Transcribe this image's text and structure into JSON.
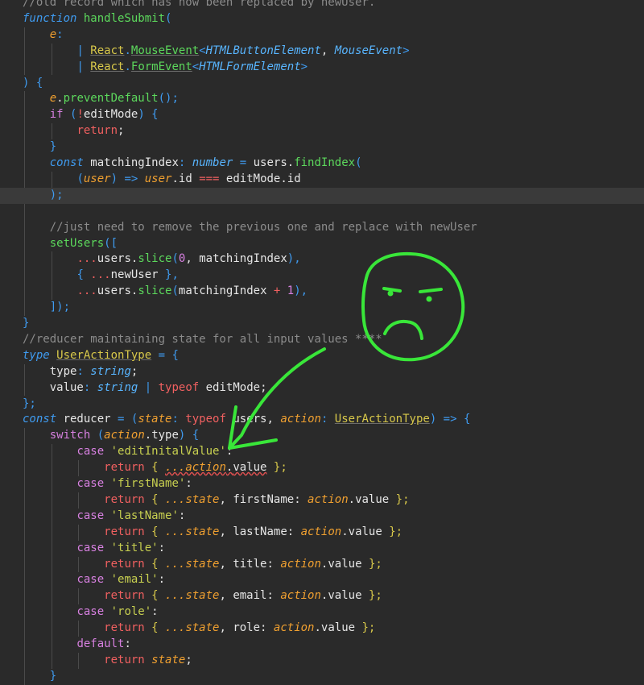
{
  "editor": {
    "background": "#2a2a2a",
    "highlight_color": "#3a3a3a",
    "annotation_color": "#39e639",
    "lines": [
      [
        {
          "t": "//old record which has now been replaced by newUser.",
          "c": "tok-comment"
        }
      ],
      [
        {
          "t": "function ",
          "c": "tok-storage"
        },
        {
          "t": "handleSubmit",
          "c": "tok-func"
        },
        {
          "t": "(",
          "c": "tok-punct"
        }
      ],
      [
        {
          "t": "    ",
          "c": "tok-ident"
        },
        {
          "t": "e",
          "c": "tok-param"
        },
        {
          "t": ":",
          "c": "tok-punct"
        }
      ],
      [
        {
          "t": "        ",
          "c": "tok-ident"
        },
        {
          "t": "| ",
          "c": "tok-punct"
        },
        {
          "t": "React",
          "c": "tok-typeu"
        },
        {
          "t": ".",
          "c": "tok-punct"
        },
        {
          "t": "MouseEvent",
          "c": "tok-typeg"
        },
        {
          "t": "<",
          "c": "tok-punct"
        },
        {
          "t": "HTMLButtonElement",
          "c": "tok-type"
        },
        {
          "t": ", ",
          "c": "tok-ident"
        },
        {
          "t": "MouseEvent",
          "c": "tok-type"
        },
        {
          "t": ">",
          "c": "tok-punct"
        }
      ],
      [
        {
          "t": "        ",
          "c": "tok-ident"
        },
        {
          "t": "| ",
          "c": "tok-punct"
        },
        {
          "t": "React",
          "c": "tok-typeu"
        },
        {
          "t": ".",
          "c": "tok-punct"
        },
        {
          "t": "FormEvent",
          "c": "tok-typeg"
        },
        {
          "t": "<",
          "c": "tok-punct"
        },
        {
          "t": "HTMLFormElement",
          "c": "tok-type"
        },
        {
          "t": ">",
          "c": "tok-punct"
        }
      ],
      [
        {
          "t": ") {",
          "c": "tok-punct"
        }
      ],
      [
        {
          "t": "    ",
          "c": "tok-ident"
        },
        {
          "t": "e",
          "c": "tok-param"
        },
        {
          "t": ".",
          "c": "tok-ident"
        },
        {
          "t": "preventDefault",
          "c": "tok-func"
        },
        {
          "t": "();",
          "c": "tok-punct"
        }
      ],
      [
        {
          "t": "    ",
          "c": "tok-ident"
        },
        {
          "t": "if ",
          "c": "tok-ctl"
        },
        {
          "t": "(",
          "c": "tok-punct"
        },
        {
          "t": "!",
          "c": "tok-ret"
        },
        {
          "t": "editMode",
          "c": "tok-ident"
        },
        {
          "t": ") {",
          "c": "tok-punct"
        }
      ],
      [
        {
          "t": "        ",
          "c": "tok-ident"
        },
        {
          "t": "return",
          "c": "tok-ret"
        },
        {
          "t": ";",
          "c": "tok-ident"
        }
      ],
      [
        {
          "t": "    ",
          "c": "tok-ident"
        },
        {
          "t": "}",
          "c": "tok-punct"
        }
      ],
      [
        {
          "t": "    ",
          "c": "tok-ident"
        },
        {
          "t": "const ",
          "c": "tok-storage"
        },
        {
          "t": "matchingIndex",
          "c": "tok-ident"
        },
        {
          "t": ": ",
          "c": "tok-punct"
        },
        {
          "t": "number",
          "c": "tok-type"
        },
        {
          "t": " = ",
          "c": "tok-punct"
        },
        {
          "t": "users",
          "c": "tok-ident"
        },
        {
          "t": ".",
          "c": "tok-ident"
        },
        {
          "t": "findIndex",
          "c": "tok-func"
        },
        {
          "t": "(",
          "c": "tok-punct"
        }
      ],
      [
        {
          "t": "        ",
          "c": "tok-ident"
        },
        {
          "t": "(",
          "c": "tok-punct"
        },
        {
          "t": "user",
          "c": "tok-param"
        },
        {
          "t": ") => ",
          "c": "tok-punct"
        },
        {
          "t": "user",
          "c": "tok-param"
        },
        {
          "t": ".",
          "c": "tok-ident"
        },
        {
          "t": "id",
          "c": "tok-ident"
        },
        {
          "t": " === ",
          "c": "tok-ret"
        },
        {
          "t": "editMode",
          "c": "tok-ident"
        },
        {
          "t": ".",
          "c": "tok-ident"
        },
        {
          "t": "id",
          "c": "tok-ident"
        }
      ],
      [
        {
          "t": "    ",
          "c": "tok-ident"
        },
        {
          "t": ");",
          "c": "tok-punct"
        }
      ],
      [],
      [
        {
          "t": "    ",
          "c": "tok-ident"
        },
        {
          "t": "//just need to remove the previous one and replace with newUser",
          "c": "tok-comment"
        }
      ],
      [
        {
          "t": "    ",
          "c": "tok-ident"
        },
        {
          "t": "setUsers",
          "c": "tok-func"
        },
        {
          "t": "([",
          "c": "tok-punct"
        }
      ],
      [
        {
          "t": "        ",
          "c": "tok-ident"
        },
        {
          "t": "...",
          "c": "tok-ret"
        },
        {
          "t": "users",
          "c": "tok-ident"
        },
        {
          "t": ".",
          "c": "tok-ident"
        },
        {
          "t": "slice",
          "c": "tok-func"
        },
        {
          "t": "(",
          "c": "tok-punct"
        },
        {
          "t": "0",
          "c": "tok-num"
        },
        {
          "t": ", ",
          "c": "tok-ident"
        },
        {
          "t": "matchingIndex",
          "c": "tok-ident"
        },
        {
          "t": "),",
          "c": "tok-punct"
        }
      ],
      [
        {
          "t": "        ",
          "c": "tok-ident"
        },
        {
          "t": "{ ",
          "c": "tok-punct"
        },
        {
          "t": "...",
          "c": "tok-ret"
        },
        {
          "t": "newUser",
          "c": "tok-ident"
        },
        {
          "t": " },",
          "c": "tok-punct"
        }
      ],
      [
        {
          "t": "        ",
          "c": "tok-ident"
        },
        {
          "t": "...",
          "c": "tok-ret"
        },
        {
          "t": "users",
          "c": "tok-ident"
        },
        {
          "t": ".",
          "c": "tok-ident"
        },
        {
          "t": "slice",
          "c": "tok-func"
        },
        {
          "t": "(",
          "c": "tok-punct"
        },
        {
          "t": "matchingIndex",
          "c": "tok-ident"
        },
        {
          "t": " + ",
          "c": "tok-ret"
        },
        {
          "t": "1",
          "c": "tok-num"
        },
        {
          "t": "),",
          "c": "tok-punct"
        }
      ],
      [
        {
          "t": "    ",
          "c": "tok-ident"
        },
        {
          "t": "]);",
          "c": "tok-punct"
        }
      ],
      [
        {
          "t": "}",
          "c": "tok-punct"
        }
      ],
      [
        {
          "t": "//reducer maintaining state for all input values ****",
          "c": "tok-comment"
        }
      ],
      [
        {
          "t": "type ",
          "c": "tok-storage"
        },
        {
          "t": "UserActionType",
          "c": "tok-typeu"
        },
        {
          "t": " = {",
          "c": "tok-punct"
        }
      ],
      [
        {
          "t": "    ",
          "c": "tok-ident"
        },
        {
          "t": "type",
          "c": "tok-ident"
        },
        {
          "t": ": ",
          "c": "tok-punct"
        },
        {
          "t": "string",
          "c": "tok-type"
        },
        {
          "t": ";",
          "c": "tok-ident"
        }
      ],
      [
        {
          "t": "    ",
          "c": "tok-ident"
        },
        {
          "t": "value",
          "c": "tok-ident"
        },
        {
          "t": ": ",
          "c": "tok-punct"
        },
        {
          "t": "string",
          "c": "tok-type"
        },
        {
          "t": " | ",
          "c": "tok-punct"
        },
        {
          "t": "typeof ",
          "c": "tok-ret"
        },
        {
          "t": "editMode",
          "c": "tok-ident"
        },
        {
          "t": ";",
          "c": "tok-ident"
        }
      ],
      [
        {
          "t": "};",
          "c": "tok-punct"
        }
      ],
      [
        {
          "t": "const ",
          "c": "tok-storage"
        },
        {
          "t": "reducer",
          "c": "tok-ident"
        },
        {
          "t": " = (",
          "c": "tok-punct"
        },
        {
          "t": "state",
          "c": "tok-param"
        },
        {
          "t": ": ",
          "c": "tok-punct"
        },
        {
          "t": "typeof ",
          "c": "tok-ret"
        },
        {
          "t": "users",
          "c": "tok-ident"
        },
        {
          "t": ", ",
          "c": "tok-ident"
        },
        {
          "t": "action",
          "c": "tok-param"
        },
        {
          "t": ": ",
          "c": "tok-punct"
        },
        {
          "t": "UserActionType",
          "c": "tok-typeu"
        },
        {
          "t": ") => {",
          "c": "tok-punct"
        }
      ],
      [
        {
          "t": "    ",
          "c": "tok-ident"
        },
        {
          "t": "switch ",
          "c": "tok-ctl"
        },
        {
          "t": "(",
          "c": "tok-punct"
        },
        {
          "t": "action",
          "c": "tok-param"
        },
        {
          "t": ".",
          "c": "tok-ident"
        },
        {
          "t": "type",
          "c": "tok-ident"
        },
        {
          "t": ") {",
          "c": "tok-punct"
        }
      ],
      [
        {
          "t": "        ",
          "c": "tok-ident"
        },
        {
          "t": "case ",
          "c": "tok-case"
        },
        {
          "t": "'editInitalValue'",
          "c": "tok-string"
        },
        {
          "t": ":",
          "c": "tok-ident"
        }
      ],
      [
        {
          "t": "            ",
          "c": "tok-ident"
        },
        {
          "t": "return ",
          "c": "tok-ret"
        },
        {
          "t": "{ ",
          "c": "tok-paramu"
        },
        {
          "t": "...action",
          "c": "tok-param tok-squig"
        },
        {
          "t": ".",
          "c": "tok-ident tok-squig"
        },
        {
          "t": "value",
          "c": "tok-ident tok-squig"
        },
        {
          "t": " };",
          "c": "tok-paramu"
        }
      ],
      [
        {
          "t": "        ",
          "c": "tok-ident"
        },
        {
          "t": "case ",
          "c": "tok-case"
        },
        {
          "t": "'firstName'",
          "c": "tok-string"
        },
        {
          "t": ":",
          "c": "tok-ident"
        }
      ],
      [
        {
          "t": "            ",
          "c": "tok-ident"
        },
        {
          "t": "return ",
          "c": "tok-ret"
        },
        {
          "t": "{ ",
          "c": "tok-paramu"
        },
        {
          "t": "...state",
          "c": "tok-param"
        },
        {
          "t": ", ",
          "c": "tok-ident"
        },
        {
          "t": "firstName",
          "c": "tok-ident"
        },
        {
          "t": ": ",
          "c": "tok-ident"
        },
        {
          "t": "action",
          "c": "tok-param"
        },
        {
          "t": ".",
          "c": "tok-ident"
        },
        {
          "t": "value",
          "c": "tok-ident"
        },
        {
          "t": " };",
          "c": "tok-paramu"
        }
      ],
      [
        {
          "t": "        ",
          "c": "tok-ident"
        },
        {
          "t": "case ",
          "c": "tok-case"
        },
        {
          "t": "'lastName'",
          "c": "tok-string"
        },
        {
          "t": ":",
          "c": "tok-ident"
        }
      ],
      [
        {
          "t": "            ",
          "c": "tok-ident"
        },
        {
          "t": "return ",
          "c": "tok-ret"
        },
        {
          "t": "{ ",
          "c": "tok-paramu"
        },
        {
          "t": "...state",
          "c": "tok-param"
        },
        {
          "t": ", ",
          "c": "tok-ident"
        },
        {
          "t": "lastName",
          "c": "tok-ident"
        },
        {
          "t": ": ",
          "c": "tok-ident"
        },
        {
          "t": "action",
          "c": "tok-param"
        },
        {
          "t": ".",
          "c": "tok-ident"
        },
        {
          "t": "value",
          "c": "tok-ident"
        },
        {
          "t": " };",
          "c": "tok-paramu"
        }
      ],
      [
        {
          "t": "        ",
          "c": "tok-ident"
        },
        {
          "t": "case ",
          "c": "tok-case"
        },
        {
          "t": "'title'",
          "c": "tok-string"
        },
        {
          "t": ":",
          "c": "tok-ident"
        }
      ],
      [
        {
          "t": "            ",
          "c": "tok-ident"
        },
        {
          "t": "return ",
          "c": "tok-ret"
        },
        {
          "t": "{ ",
          "c": "tok-paramu"
        },
        {
          "t": "...state",
          "c": "tok-param"
        },
        {
          "t": ", ",
          "c": "tok-ident"
        },
        {
          "t": "title",
          "c": "tok-ident"
        },
        {
          "t": ": ",
          "c": "tok-ident"
        },
        {
          "t": "action",
          "c": "tok-param"
        },
        {
          "t": ".",
          "c": "tok-ident"
        },
        {
          "t": "value",
          "c": "tok-ident"
        },
        {
          "t": " };",
          "c": "tok-paramu"
        }
      ],
      [
        {
          "t": "        ",
          "c": "tok-ident"
        },
        {
          "t": "case ",
          "c": "tok-case"
        },
        {
          "t": "'email'",
          "c": "tok-string"
        },
        {
          "t": ":",
          "c": "tok-ident"
        }
      ],
      [
        {
          "t": "            ",
          "c": "tok-ident"
        },
        {
          "t": "return ",
          "c": "tok-ret"
        },
        {
          "t": "{ ",
          "c": "tok-paramu"
        },
        {
          "t": "...state",
          "c": "tok-param"
        },
        {
          "t": ", ",
          "c": "tok-ident"
        },
        {
          "t": "email",
          "c": "tok-ident"
        },
        {
          "t": ": ",
          "c": "tok-ident"
        },
        {
          "t": "action",
          "c": "tok-param"
        },
        {
          "t": ".",
          "c": "tok-ident"
        },
        {
          "t": "value",
          "c": "tok-ident"
        },
        {
          "t": " };",
          "c": "tok-paramu"
        }
      ],
      [
        {
          "t": "        ",
          "c": "tok-ident"
        },
        {
          "t": "case ",
          "c": "tok-case"
        },
        {
          "t": "'role'",
          "c": "tok-string"
        },
        {
          "t": ":",
          "c": "tok-ident"
        }
      ],
      [
        {
          "t": "            ",
          "c": "tok-ident"
        },
        {
          "t": "return ",
          "c": "tok-ret"
        },
        {
          "t": "{ ",
          "c": "tok-paramu"
        },
        {
          "t": "...state",
          "c": "tok-param"
        },
        {
          "t": ", ",
          "c": "tok-ident"
        },
        {
          "t": "role",
          "c": "tok-ident"
        },
        {
          "t": ": ",
          "c": "tok-ident"
        },
        {
          "t": "action",
          "c": "tok-param"
        },
        {
          "t": ".",
          "c": "tok-ident"
        },
        {
          "t": "value",
          "c": "tok-ident"
        },
        {
          "t": " };",
          "c": "tok-paramu"
        }
      ],
      [
        {
          "t": "        ",
          "c": "tok-ident"
        },
        {
          "t": "default",
          "c": "tok-case"
        },
        {
          "t": ":",
          "c": "tok-ident"
        }
      ],
      [
        {
          "t": "            ",
          "c": "tok-ident"
        },
        {
          "t": "return ",
          "c": "tok-ret"
        },
        {
          "t": "state",
          "c": "tok-param"
        },
        {
          "t": ";",
          "c": "tok-ident"
        }
      ],
      [
        {
          "t": "    ",
          "c": "tok-ident"
        },
        {
          "t": "}",
          "c": "tok-punct"
        }
      ]
    ],
    "highlighted_line": 12
  },
  "annotation": {
    "face_icon": "angry-face-drawing",
    "arrow_icon": "hand-drawn-arrow"
  }
}
